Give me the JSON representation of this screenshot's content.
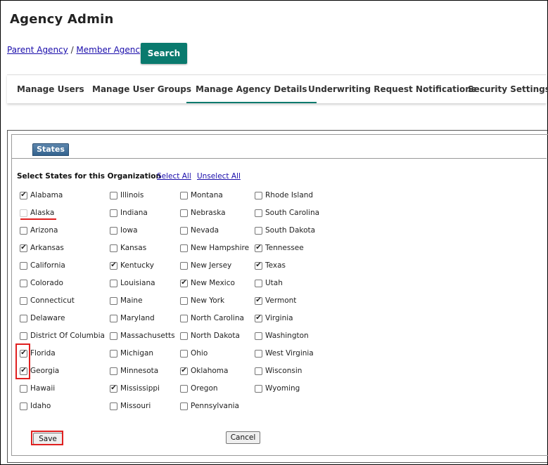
{
  "page": {
    "title": "Agency Admin"
  },
  "breadcrumb": {
    "parent": "Parent Agency",
    "separator": " / ",
    "child": "Member Agency A"
  },
  "search": {
    "label": "Search"
  },
  "tabs": [
    {
      "label": "Manage Users"
    },
    {
      "label": "Manage User Groups"
    },
    {
      "label": "Manage Agency Details",
      "active": true
    },
    {
      "label": "Underwriting Request Notifications"
    },
    {
      "label": "Security Settings"
    }
  ],
  "states_panel": {
    "tab_label": "States",
    "select_label": "Select States for this Organization",
    "select_all": "Select All",
    "unselect_all": "Unselect All",
    "states": [
      {
        "name": "Alabama",
        "checked": true
      },
      {
        "name": "Alaska",
        "checked": false,
        "disabled": true
      },
      {
        "name": "Arizona",
        "checked": false
      },
      {
        "name": "Arkansas",
        "checked": true
      },
      {
        "name": "California",
        "checked": false
      },
      {
        "name": "Colorado",
        "checked": false
      },
      {
        "name": "Connecticut",
        "checked": false
      },
      {
        "name": "Delaware",
        "checked": false
      },
      {
        "name": "District Of Columbia",
        "checked": false
      },
      {
        "name": "Florida",
        "checked": true
      },
      {
        "name": "Georgia",
        "checked": true
      },
      {
        "name": "Hawaii",
        "checked": false
      },
      {
        "name": "Idaho",
        "checked": false
      },
      {
        "name": "Illinois",
        "checked": false
      },
      {
        "name": "Indiana",
        "checked": false
      },
      {
        "name": "Iowa",
        "checked": false
      },
      {
        "name": "Kansas",
        "checked": false
      },
      {
        "name": "Kentucky",
        "checked": true
      },
      {
        "name": "Louisiana",
        "checked": false
      },
      {
        "name": "Maine",
        "checked": false
      },
      {
        "name": "Maryland",
        "checked": false
      },
      {
        "name": "Massachusetts",
        "checked": false
      },
      {
        "name": "Michigan",
        "checked": false
      },
      {
        "name": "Minnesota",
        "checked": false
      },
      {
        "name": "Mississippi",
        "checked": true
      },
      {
        "name": "Missouri",
        "checked": false
      },
      {
        "name": "Montana",
        "checked": false
      },
      {
        "name": "Nebraska",
        "checked": false
      },
      {
        "name": "Nevada",
        "checked": false
      },
      {
        "name": "New Hampshire",
        "checked": false
      },
      {
        "name": "New Jersey",
        "checked": false
      },
      {
        "name": "New Mexico",
        "checked": true
      },
      {
        "name": "New York",
        "checked": false
      },
      {
        "name": "North Carolina",
        "checked": false
      },
      {
        "name": "North Dakota",
        "checked": false
      },
      {
        "name": "Ohio",
        "checked": false
      },
      {
        "name": "Oklahoma",
        "checked": true
      },
      {
        "name": "Oregon",
        "checked": false
      },
      {
        "name": "Pennsylvania",
        "checked": false
      },
      {
        "name": "Rhode Island",
        "checked": false
      },
      {
        "name": "South Carolina",
        "checked": false
      },
      {
        "name": "South Dakota",
        "checked": false
      },
      {
        "name": "Tennessee",
        "checked": true
      },
      {
        "name": "Texas",
        "checked": true
      },
      {
        "name": "Utah",
        "checked": false
      },
      {
        "name": "Vermont",
        "checked": true
      },
      {
        "name": "Virginia",
        "checked": true
      },
      {
        "name": "Washington",
        "checked": false
      },
      {
        "name": "West Virginia",
        "checked": false
      },
      {
        "name": "Wisconsin",
        "checked": false
      },
      {
        "name": "Wyoming",
        "checked": false
      }
    ],
    "save_label": "Save",
    "cancel_label": "Cancel"
  },
  "colors": {
    "accent": "#0a7a6e",
    "highlight": "#e02020",
    "states_tab": "#3d6a94"
  },
  "icons": {
    "check": "check-icon"
  }
}
